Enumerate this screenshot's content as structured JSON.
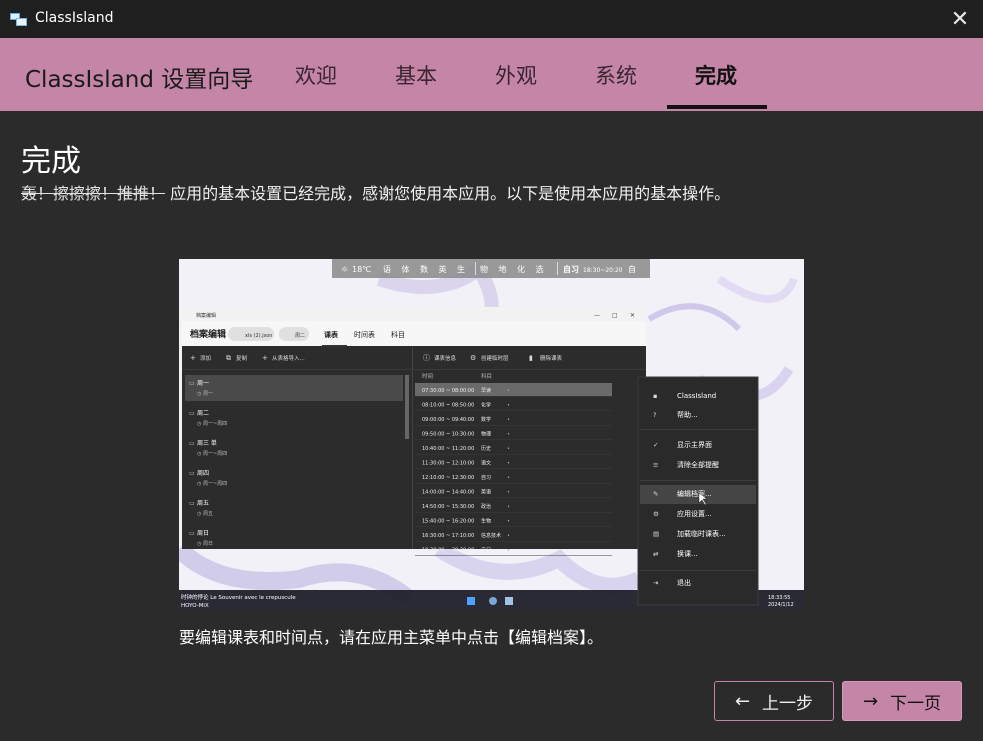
{
  "window": {
    "title": "ClassIsland",
    "close_glyph": "✕"
  },
  "header": {
    "app_title": "ClassIsland 设置向导",
    "tabs": [
      {
        "label": "欢迎",
        "active": false
      },
      {
        "label": "基本",
        "active": false
      },
      {
        "label": "外观",
        "active": false
      },
      {
        "label": "系统",
        "active": false
      },
      {
        "label": "完成",
        "active": true
      }
    ],
    "accent_color": "#c485a6"
  },
  "content": {
    "title": "完成",
    "desc_strike": "轰！擦擦擦！推推！",
    "desc_text": "应用的基本设置已经完成，感谢您使用本应用。以下是使用本应用的基本操作。",
    "caption": "要编辑课表和时间点，请在应用主菜单中点击【编辑档案】。"
  },
  "screenshot": {
    "island_bar": {
      "weather": "18℃",
      "subjects_today": [
        "语",
        "体",
        "数",
        "英",
        "生"
      ],
      "subjects_later": [
        "物",
        "地",
        "化",
        "选"
      ],
      "current": "自习",
      "current_time": "18:30~20:20",
      "next": "自"
    },
    "editor": {
      "window_title": "档案编辑",
      "title": "档案编辑",
      "profile_chip": "xls (2).json",
      "day_chip": "周二",
      "tabs": [
        "课表",
        "时间表",
        "科目"
      ],
      "left_toolbar": [
        "添加",
        "复制",
        "从表格导入..."
      ],
      "right_toolbar": [
        "课表信息",
        "创建临时层",
        "删除课表"
      ],
      "schedules": [
        {
          "name": "周一",
          "rule": "周一"
        },
        {
          "name": "周二",
          "rule": "周一~周四"
        },
        {
          "name": "周三 单",
          "rule": "周一~周四"
        },
        {
          "name": "周四",
          "rule": "周一~周四"
        },
        {
          "name": "周五",
          "rule": "周五"
        },
        {
          "name": "周日",
          "rule": "周日"
        }
      ],
      "columns": [
        "时间",
        "科目"
      ],
      "rows": [
        {
          "time": "07:30:00 ~ 08:00:00",
          "subject": "早读"
        },
        {
          "time": "08:10:00 ~ 08:50:00",
          "subject": "化学"
        },
        {
          "time": "09:00:00 ~ 09:40:00",
          "subject": "数学"
        },
        {
          "time": "09:50:00 ~ 10:30:00",
          "subject": "物理"
        },
        {
          "time": "10:40:00 ~ 11:20:00",
          "subject": "历史"
        },
        {
          "time": "11:30:00 ~ 12:10:00",
          "subject": "语文"
        },
        {
          "time": "12:10:00 ~ 12:30:00",
          "subject": "自习"
        },
        {
          "time": "14:00:00 ~ 14:40:00",
          "subject": "英语"
        },
        {
          "time": "14:50:00 ~ 15:30:00",
          "subject": "政治"
        },
        {
          "time": "15:40:00 ~ 16:20:00",
          "subject": "生物"
        },
        {
          "time": "16:30:00 ~ 17:10:00",
          "subject": "信息技术"
        },
        {
          "time": "18:30:00 ~ 20:20:00",
          "subject": "自习"
        }
      ]
    },
    "context_menu": [
      {
        "label": "ClassIsland",
        "icon": "app-icon"
      },
      {
        "label": "帮助...",
        "icon": "help-icon"
      },
      {
        "label": "显示主界面",
        "icon": "check-icon"
      },
      {
        "label": "清除全部提醒",
        "icon": "clear-icon"
      },
      {
        "label": "编辑档案...",
        "icon": "edit-icon",
        "highlighted": true
      },
      {
        "label": "应用设置...",
        "icon": "gear-icon"
      },
      {
        "label": "加载临时课表...",
        "icon": "file-icon"
      },
      {
        "label": "换课...",
        "icon": "swap-icon"
      },
      {
        "label": "退出",
        "icon": "exit-icon"
      }
    ],
    "taskbar": {
      "now_playing_title": "时钟的悖论 Le Souvenir avec le crepuscule",
      "now_playing_artist": "HOYO-MiX",
      "clock_time": "18:33:55",
      "clock_date": "2024/1/12"
    }
  },
  "buttons": {
    "prev_label": "上一步",
    "next_label": "下一页",
    "prev_arrow": "←",
    "next_arrow": "→"
  }
}
